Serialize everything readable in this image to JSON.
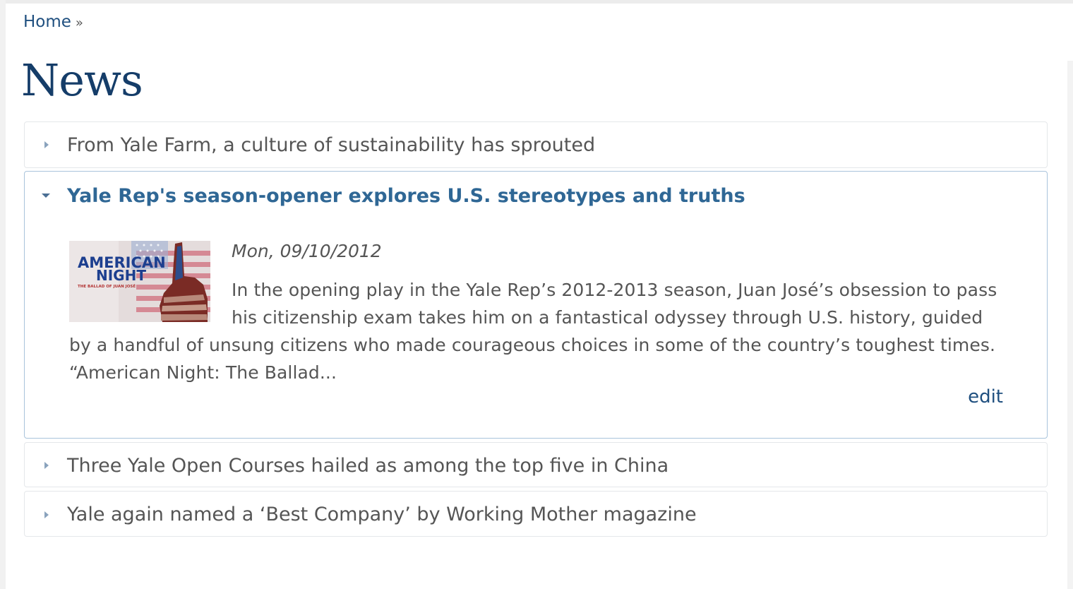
{
  "breadcrumb": {
    "home": "Home",
    "separator": "»"
  },
  "page": {
    "title": "News"
  },
  "accordion": {
    "items": [
      {
        "title": "From Yale Farm, a culture of sustainability has sprouted",
        "expanded": false
      },
      {
        "title": "Yale Rep's season-opener explores U.S. stereotypes and truths",
        "expanded": true,
        "date": "Mon, 09/10/2012",
        "summary": "In the opening play in the Yale Rep’s 2012-2013 season, Juan José’s obsession to pass his citizenship exam takes him on a fantastical odyssey through U.S. history, guided by a handful of unsung citizens who made courageous choices in some of the country’s toughest times. “American Night: The Ballad...",
        "edit_label": "edit",
        "thumbnail": {
          "line1": "AMERICAN",
          "line2": "NIGHT",
          "line3": "THE BALLAD OF JUAN JOSÉ"
        }
      },
      {
        "title": "Three Yale Open Courses hailed as among the top five in China",
        "expanded": false
      },
      {
        "title": "Yale again named a ‘Best Company’ by Working Mother magazine",
        "expanded": false
      }
    ]
  },
  "colors": {
    "link": "#1f4f7f",
    "title": "#153d69",
    "active_heading": "#2f6795",
    "text": "#555555",
    "panel_border": "#e4e7ea",
    "active_border": "#a9c4dc"
  }
}
